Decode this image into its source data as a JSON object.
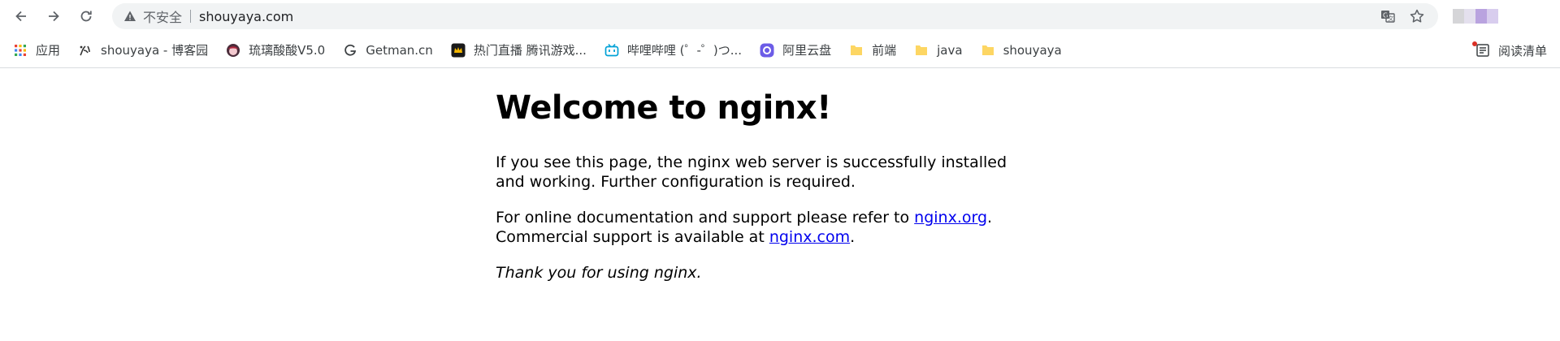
{
  "browser": {
    "security_label": "不安全",
    "url": "shouyaya.com"
  },
  "bookmarks": [
    {
      "label": "应用",
      "icon": "apps-grid-icon"
    },
    {
      "label": "shouyaya - 博客园",
      "icon": "cnblogs-icon"
    },
    {
      "label": "琉璃酸酸V5.0",
      "icon": "avatar-icon"
    },
    {
      "label": "Getman.cn",
      "icon": "letter-g-icon"
    },
    {
      "label": "热门直播 腾讯游戏...",
      "icon": "game-crown-icon"
    },
    {
      "label": "哔哩哔哩 (゜-゜)つ...",
      "icon": "bilibili-icon"
    },
    {
      "label": "阿里云盘",
      "icon": "aliyun-drive-icon"
    },
    {
      "label": "前端",
      "icon": "folder-icon"
    },
    {
      "label": "java",
      "icon": "folder-icon"
    },
    {
      "label": "shouyaya",
      "icon": "folder-icon"
    }
  ],
  "reading_list": {
    "label": "阅读清单",
    "icon": "reading-list-icon"
  },
  "page": {
    "heading": "Welcome to nginx!",
    "p1": "If you see this page, the nginx web server is successfully installed and working. Further configuration is required.",
    "p2_prefix": "For online documentation and support please refer to ",
    "link1": "nginx.org",
    "p2_mid": ".",
    "p2_line2_prefix": "Commercial support is available at ",
    "link2": "nginx.com",
    "p2_end": ".",
    "thanks": "Thank you for using nginx."
  },
  "colors": {
    "link": "#0000ee",
    "omnibox_bg": "#f1f3f4",
    "folder": "#fdd663"
  }
}
